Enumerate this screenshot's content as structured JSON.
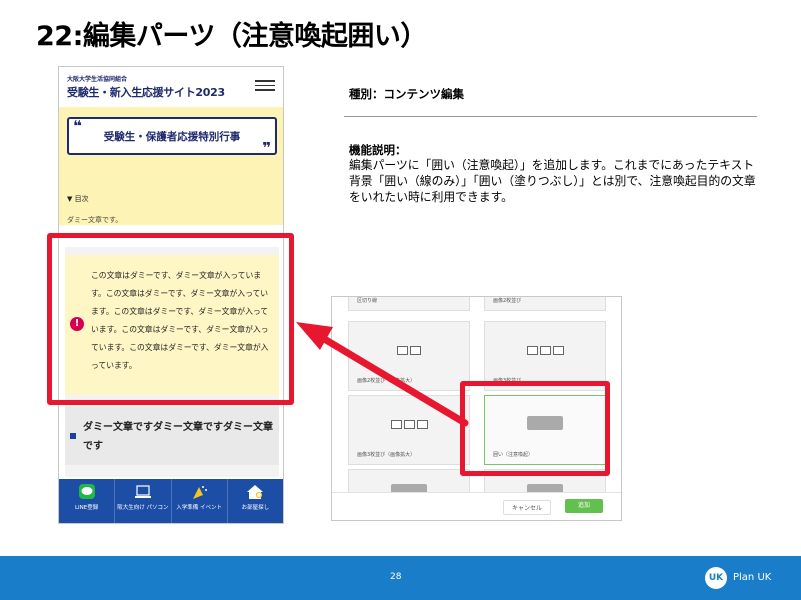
{
  "slide": {
    "title": "22:編集パーツ（注意喚起囲い）",
    "page_number": "28"
  },
  "phone": {
    "org": "大阪大学生活協同組合",
    "site_title": "受験生・新入生応援サイト2023",
    "event_title": "受験生・保護者応援特別行事",
    "quote_open": "❝",
    "quote_close": "❞",
    "toc_label": "▼ 目次",
    "dummy_short": "ダミー文章です。",
    "alert_icon": "!",
    "alert_text": "この文章はダミーです、ダミー文章が入っています。この文章はダミーです、ダミー文章が入っています。この文章はダミーです、ダミー文章が入っています。この文章はダミーです、ダミー文章が入っています。この文章はダミーです、ダミー文章が入っています。",
    "heading_text": "ダミー文章ですダミー文章ですダミー文章です",
    "footer": [
      {
        "label": "LINE登録",
        "icon": "line-icon"
      },
      {
        "label": "阪大生向け パソコン",
        "icon": "laptop-icon"
      },
      {
        "label": "入学準備 イベント",
        "icon": "party-icon"
      },
      {
        "label": "お部屋探し",
        "icon": "house-search-icon"
      }
    ]
  },
  "info": {
    "type_label": "種別：コンテンツ編集",
    "func_heading": "機能説明：",
    "func_desc": "編集パーツに「囲い（注意喚起）」を追加します。これまでにあったテキスト背景「囲い（線のみ）」「囲い（塗りつぶし）」とは別で、注意喚起目的の文章をいれたい時に利用できます。"
  },
  "editor": {
    "cells": [
      {
        "caption": "区切り線"
      },
      {
        "caption": "画像2枚並び"
      },
      {
        "caption": "画像2枚並び（画像拡大）"
      },
      {
        "caption": "画像3枚並び"
      },
      {
        "caption": "画像3枚並び（画像拡大）"
      },
      {
        "caption": "囲い（注意喚起）"
      }
    ],
    "cancel_label": "キャンセル",
    "add_label": "追加"
  },
  "brand": {
    "name": "Plan UK",
    "mark": "UK"
  },
  "colors": {
    "highlight_red": "#e6172e",
    "footer_blue": "#1a7dc9",
    "phone_navy": "#1e2a6e",
    "alert_yellow": "#fff6c6",
    "add_green": "#62c04f"
  }
}
